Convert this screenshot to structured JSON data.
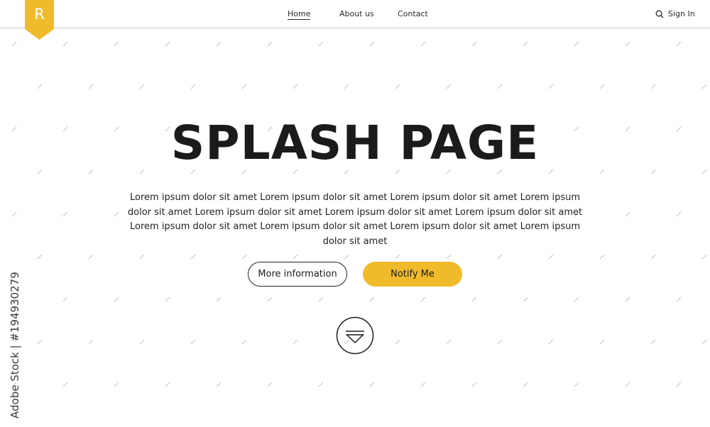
{
  "brand": {
    "logo_letter": "R",
    "accent_color": "#f0bb2b"
  },
  "nav": {
    "items": [
      {
        "label": "Home",
        "active": true
      },
      {
        "label": "About us",
        "active": false
      },
      {
        "label": "Contact",
        "active": false
      }
    ],
    "search_icon": "search-icon",
    "sign_in_label": "Sign In"
  },
  "hero": {
    "title": "SPLASH PAGE",
    "body": "Lorem ipsum dolor sit amet Lorem ipsum dolor sit amet Lorem ipsum dolor sit amet Lorem ipsum dolor sit amet Lorem ipsum dolor sit amet Lorem ipsum dolor sit amet Lorem ipsum dolor sit amet Lorem ipsum dolor sit amet Lorem ipsum dolor sit amet Lorem ipsum dolor sit amet Lorem ipsum dolor sit amet",
    "more_info_label": "More information",
    "notify_label": "Notify Me",
    "scroll_icon": "scroll-down-icon"
  },
  "watermark": {
    "text": "Adobe Stock | #194930279"
  }
}
